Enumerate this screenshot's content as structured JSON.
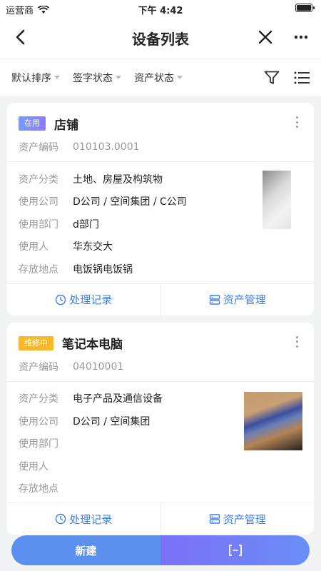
{
  "status_bar": {
    "carrier": "运营商",
    "time": "下午 4:42"
  },
  "nav": {
    "title": "设备列表"
  },
  "filters": [
    {
      "label": "默认排序"
    },
    {
      "label": "签字状态"
    },
    {
      "label": "资产状态"
    }
  ],
  "labels": {
    "code": "资产编码",
    "category": "资产分类",
    "company": "使用公司",
    "department": "使用部门",
    "user": "使用人",
    "location": "存放地点"
  },
  "actions": {
    "records": "处理记录",
    "asset_mgmt": "资产管理"
  },
  "cards": [
    {
      "status": "在用",
      "name": "店铺",
      "code": "010103.0001",
      "category": "土地、房屋及构筑物",
      "company": "D公司 / 空间集团 / C公司",
      "department": "d部门",
      "user": "华东交大",
      "location": "电饭锅电饭锅"
    },
    {
      "status": "维修中",
      "name": "笔记本电脑",
      "code": "04010001",
      "category": "电子产品及通信设备",
      "company": "D公司 / 空间集团",
      "department": "",
      "user": "",
      "location": ""
    }
  ],
  "bottom": {
    "new_label": "新建"
  },
  "colors": {
    "accent": "#3d7eea",
    "badge_active": "#8c7bff",
    "badge_repair": "#f7b92b"
  }
}
